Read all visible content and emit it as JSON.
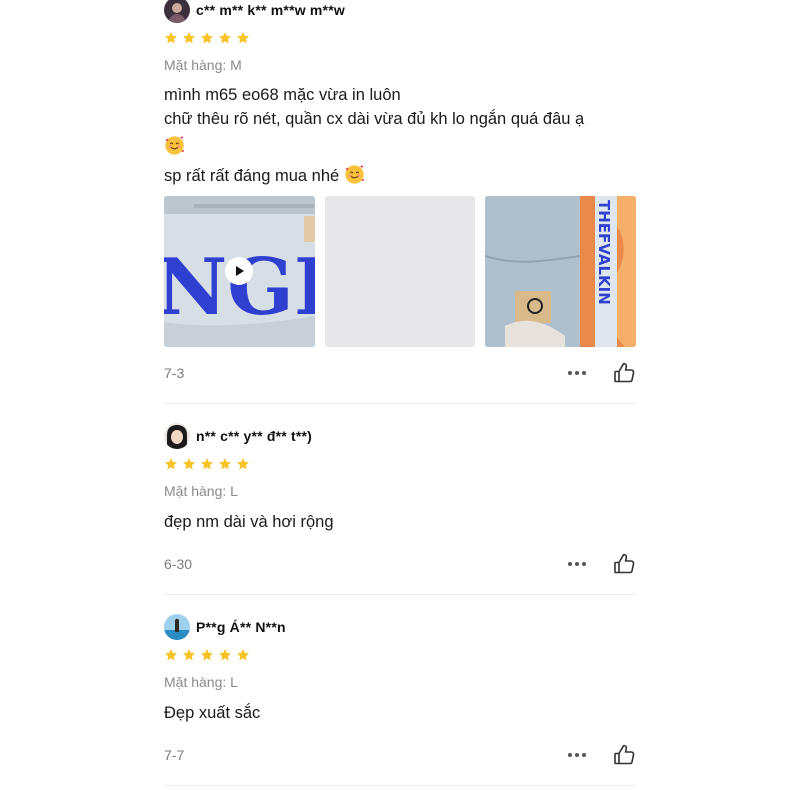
{
  "reviews": [
    {
      "username": "c** m** k** m**w m**w",
      "variant": "Mặt hàng: M",
      "comment_lines": [
        "mình m65 eo68 mặc vừa in luôn",
        "chữ thêu rõ nét, quần cx dài vừa đủ kh lo ngắn quá đâu ạ"
      ],
      "comment_extra": "sp rất rất đáng mua nhé",
      "media_text_1": "NGER",
      "media_text_3": "THEFVALKIN",
      "date": "7-3",
      "rating": 5
    },
    {
      "username": "n** c** y** đ** t**)",
      "variant": "Mặt hàng: L",
      "comment": "đẹp nm dài và hơi rộng",
      "date": "6-30",
      "rating": 5
    },
    {
      "username": "P**g Á** N**n",
      "variant": "Mặt hàng: L",
      "comment": "Đẹp xuất sắc",
      "date": "7-7",
      "rating": 5
    }
  ],
  "colors": {
    "star": "#f7c326",
    "muted": "#8a8a8a",
    "divider": "#ececec",
    "denim_blue": "#2f3fd0"
  },
  "icons": {
    "star": "star-icon",
    "more": "more-dots-icon",
    "like": "thumbs-up-icon",
    "play": "play-icon",
    "emoji": "smiling-face-with-hearts-emoji"
  }
}
